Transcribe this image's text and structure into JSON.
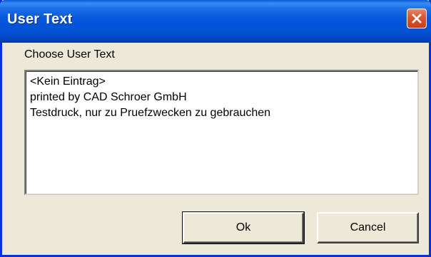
{
  "window": {
    "title": "User Text",
    "close_icon": "close-icon"
  },
  "dialog": {
    "prompt": "Choose User Text",
    "items": [
      {
        "label": "<Kein Eintrag>"
      },
      {
        "label": "printed by CAD Schroer GmbH"
      },
      {
        "label": "Testdruck, nur zu Pruefzwecken zu gebrauchen"
      }
    ]
  },
  "buttons": {
    "ok_label": "Ok",
    "cancel_label": "Cancel"
  },
  "colors": {
    "titlebar": "#0452d4",
    "close_button": "#d85a35",
    "dialog_background": "#ece9d8"
  }
}
